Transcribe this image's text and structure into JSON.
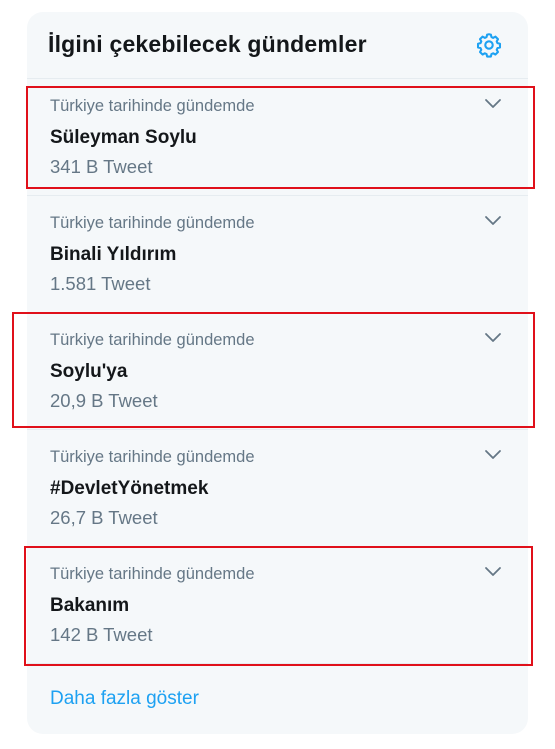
{
  "header": {
    "title": "İlgini çekebilecek gündemler",
    "settings_icon": "gear-icon"
  },
  "trends": [
    {
      "context": "Türkiye tarihinde gündemde",
      "name": "Süleyman Soylu",
      "count": "341 B Tweet",
      "highlighted": true
    },
    {
      "context": "Türkiye tarihinde gündemde",
      "name": "Binali Yıldırım",
      "count": "1.581 Tweet",
      "highlighted": false
    },
    {
      "context": "Türkiye tarihinde gündemde",
      "name": "Soylu'ya",
      "count": "20,9 B Tweet",
      "highlighted": true
    },
    {
      "context": "Türkiye tarihinde gündemde",
      "name": "#DevletYönetmek",
      "count": "26,7 B Tweet",
      "highlighted": false
    },
    {
      "context": "Türkiye tarihinde gündemde",
      "name": "Bakanım",
      "count": "142 B Tweet",
      "highlighted": true
    }
  ],
  "footer": {
    "show_more": "Daha fazla göster"
  },
  "colors": {
    "panel_bg": "#f5f8fa",
    "accent": "#1da1f2",
    "secondary_text": "#657786",
    "primary_text": "#14171a",
    "highlight_border": "#e0101a"
  }
}
